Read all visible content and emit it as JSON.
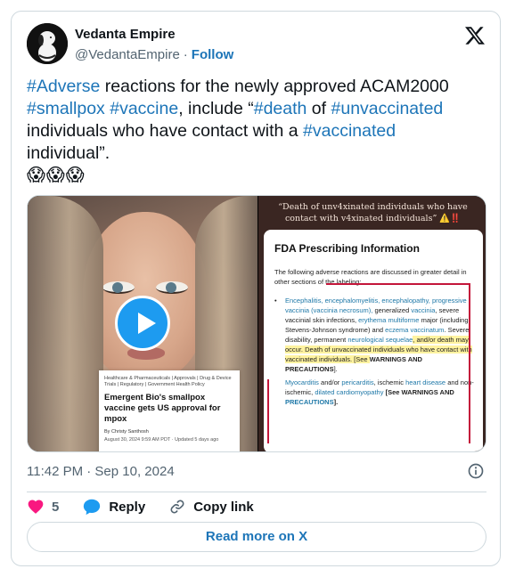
{
  "author": {
    "name": "Vedanta Empire",
    "handle": "@VedantaEmpire",
    "separator": "·",
    "follow_label": "Follow"
  },
  "tweet": {
    "parts": [
      {
        "text": "#Adverse",
        "tag": true
      },
      {
        "text": " reactions for the newly approved ACAM2000 ",
        "tag": false
      },
      {
        "text": "#smallpox",
        "tag": true
      },
      {
        "text": " ",
        "tag": false
      },
      {
        "text": "#vaccine",
        "tag": true
      },
      {
        "text": ", include “",
        "tag": false
      },
      {
        "text": "#death",
        "tag": true
      },
      {
        "text": " of ",
        "tag": false
      },
      {
        "text": "#unvaccinated",
        "tag": true
      },
      {
        "text": " individuals who have contact with a ",
        "tag": false
      },
      {
        "text": "#vaccinated",
        "tag": true
      },
      {
        "text": " individual”.",
        "tag": false
      }
    ],
    "emoji": "😱😱😱"
  },
  "media": {
    "article": {
      "categories": "Healthcare & Pharmaceuticals | Approvals | Drug & Device Trials | Regulatory | Government Health Policy",
      "headline": "Emergent Bio's smallpox vaccine gets US approval for mpox",
      "byline": "By Christy Santhosh",
      "date": "August 30, 2024 9:59 AM PDT · Updated 5 days ago"
    },
    "quote_banner": "“Death of unv4xinated individuals who have contact with v4xinated individuals”",
    "quote_banner_warn": "⚠️",
    "quote_banner_bang": "‼️",
    "fda": {
      "title": "FDA Prescribing Information",
      "intro": "The following adverse reactions are discussed in greater detail in other sections of the labeling:",
      "bullet": "•",
      "item1_links": "Encephalitis, encephalomyelitis, encephalopathy, progressive vaccinia (vaccinia necrosum),",
      "item1_a": " generalized ",
      "item1_vaccinia": "vaccinia",
      "item1_b": ", severe vaccinial skin infections, ",
      "item1_em": "erythema multiforme",
      "item1_c": " major (including Stevens-Johnson syndrome) and ",
      "item1_eczema": "eczema vaccinatum",
      "item1_d": ". Severe disability, permanent ",
      "item1_neuro": "neurological sequelae",
      "item1_e": ", and/or death may occur. Death of unvaccinated individuals who have contact with vaccinated individuals. [See ",
      "item1_warn": "WARNINGS AND PRECAUTIONS",
      "item1_f": "].",
      "item2_myo": "Myocarditis",
      "item2_a": " and/or ",
      "item2_peri": "pericarditis",
      "item2_b": ", ischemic ",
      "item2_heart": "heart disease",
      "item2_c": " and non-ischemic, ",
      "item2_dcm": "dilated cardiomyopathy",
      "item2_d": " [See WARNINGS AND ",
      "item2_prec": "PRECAUTIONS",
      "item2_e": "]."
    }
  },
  "timestamp": "11:42 PM · Sep 10, 2024",
  "actions": {
    "like_count": "5",
    "reply_label": "Reply",
    "copy_label": "Copy link"
  },
  "read_more_label": "Read more on X",
  "colors": {
    "link": "#1d75b8",
    "like": "#f91880",
    "reply": "#1d9bf0",
    "play": "#1d9bf0"
  }
}
